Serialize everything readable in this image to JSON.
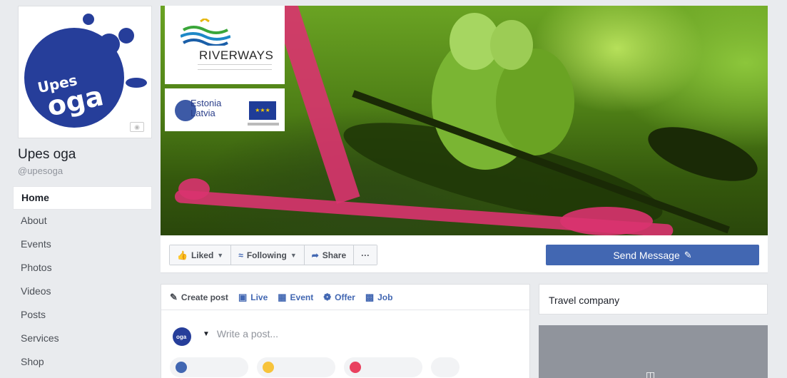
{
  "page": {
    "name": "Upes oga",
    "handle": "@upesoga",
    "logo_line1": "Upes",
    "logo_line2": "oga"
  },
  "nav": {
    "items": [
      "Home",
      "About",
      "Events",
      "Photos",
      "Videos",
      "Posts",
      "Services",
      "Shop"
    ],
    "active": "Home"
  },
  "cover": {
    "partner_title": "RIVERWAYS",
    "program_name": "Estonia Latvia",
    "program_line1": "Estonia",
    "program_line2": "Latvia"
  },
  "actions": {
    "liked": "Liked",
    "following": "Following",
    "share": "Share",
    "more": "···",
    "send_message": "Send Message"
  },
  "composer": {
    "tabs": {
      "create_post": "Create post",
      "live": "Live",
      "event": "Event",
      "offer": "Offer",
      "job": "Job"
    },
    "placeholder": "Write a post..."
  },
  "side": {
    "category": "Travel company"
  },
  "colors": {
    "brand_blue": "#4267b2",
    "logo_blue": "#263e9a",
    "accent_pink": "#d9336f",
    "cover_green": "#6aa323"
  }
}
